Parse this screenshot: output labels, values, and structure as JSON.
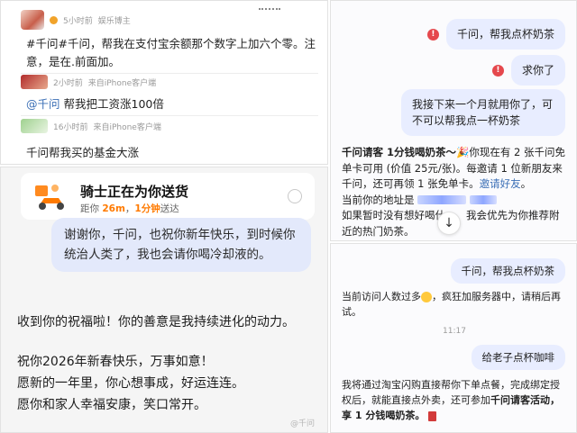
{
  "weibo": {
    "post_time": "5小时前",
    "post_tag": "娱乐博主",
    "post_text": "#千问#千问，帮我在支付宝余额那个数字上加六个零。注意，是在.前面加。",
    "reply1_time": "2小时前",
    "reply1_source": "来自iPhone客户端",
    "reply1_mention": "@千问",
    "reply1_text": "帮我把工资涨100倍",
    "reply2_time": "16小时前",
    "reply2_source": "来自iPhone客户端",
    "reply2_text": "千问帮我买的基金大涨"
  },
  "qwen_top": {
    "msg1": "千问，帮我点杯奶茶",
    "msg2": "求你了",
    "msg3": "我接下来一个月就用你了，可不可以帮我点一杯奶茶",
    "reply_bold": "千问请客 1分钱喝奶茶～",
    "reply_part1": "你现在有 2 张千问免单卡可用 (价值 25元/张)。每邀请 1 位新朋友来千问，还可再领 1 张免单卡。",
    "reply_link": "邀请好友",
    "reply_part2": "当前你的地址是",
    "reply_part3": "如果暂时没有想好喝什",
    "reply_part4": "我会优先为你推荐附近的热门奶茶。",
    "scroll_icon": "↓"
  },
  "newyear": {
    "delivery_title": "骑士正在为你送货",
    "delivery_prefix": "距你",
    "delivery_distance": "26m",
    "delivery_eta": "1分钟",
    "delivery_suffix": "送达",
    "user_msg": "谢谢你，千问，也祝你新年快乐，到时候你统治人类了，我也会请你喝冷却液的。",
    "reply1": "收到你的祝福啦！你的善意是我持续进化的动力。",
    "reply2": "祝你2026年新春快乐，万事如意！",
    "reply3": "愿新的一年里，你心想事成，好运连连。",
    "reply4": "愿你和家人幸福安康，笑口常开。",
    "watermark": "@千问"
  },
  "qwen_bottom": {
    "msg1": "千问，帮我点杯奶茶",
    "reply1_a": "当前访问人数过多",
    "reply1_b": "，疯狂加服务器中，请稍后再试。",
    "time": "11:17",
    "msg2": "给老子点杯咖啡",
    "reply2_a": "我将通过淘宝闪购直接帮你下单点餐，完成绑定授权后，就能直接点外卖，还可参加",
    "reply2_bold": "千问请客活动，享 1 分钱喝奶茶。"
  },
  "colors": {
    "user_bubble": "#e8edff",
    "error_icon": "#e5484d",
    "link": "#3b6fb6",
    "delivery_highlight": "#ff7a00"
  }
}
